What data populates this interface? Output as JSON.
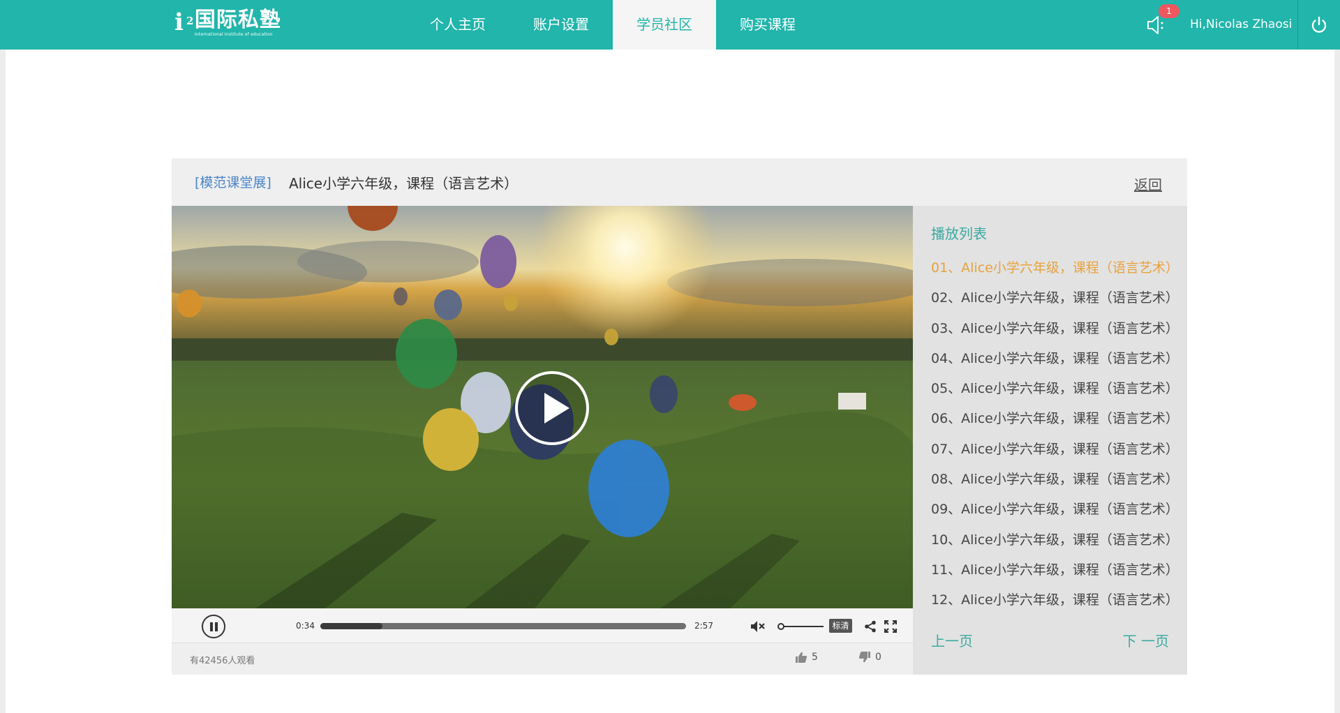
{
  "header": {
    "logo_mark": "i",
    "logo_sup": "2",
    "logo_cn": "国际私塾",
    "logo_en": "International Institute of education",
    "nav": [
      {
        "label": "个人主页",
        "active": false
      },
      {
        "label": "账户设置",
        "active": false
      },
      {
        "label": "学员社区",
        "active": true
      },
      {
        "label": "购买课程",
        "active": false
      }
    ],
    "notification_count": "1",
    "greeting": "Hi,Nicolas Zhaosi"
  },
  "card": {
    "tag": "[模范课堂展]",
    "title": "Alice小学六年级，课程（语言艺术）",
    "back_label": "返回"
  },
  "player": {
    "current_time": "0:34",
    "duration": "2:57",
    "progress": 0.17,
    "volume": 0.0,
    "muted": true,
    "quality_label": "标清",
    "viewers_text": "有42456人观看",
    "likes": "5",
    "dislikes": "0"
  },
  "playlist": {
    "title": "播放列表",
    "items": [
      "01、Alice小学六年级，课程（语言艺术）",
      "02、Alice小学六年级，课程（语言艺术）",
      "03、Alice小学六年级，课程（语言艺术）",
      "04、Alice小学六年级，课程（语言艺术）",
      "05、Alice小学六年级，课程（语言艺术）",
      "06、Alice小学六年级，课程（语言艺术）",
      "07、Alice小学六年级，课程（语言艺术）",
      "08、Alice小学六年级，课程（语言艺术）",
      "09、Alice小学六年级，课程（语言艺术）",
      "10、Alice小学六年级，课程（语言艺术）",
      "11、Alice小学六年级，课程（语言艺术）",
      "12、Alice小学六年级，课程（语言艺术）"
    ],
    "current_index": 0,
    "prev_label": "上一页",
    "next_label": "下 一页"
  },
  "colors": {
    "brand": "#21b5ab",
    "accent_current": "#e8a23c",
    "badge": "#f0575e",
    "tag_blue": "#4a86c9"
  },
  "icons": {
    "speaker": "speaker-icon",
    "power": "power-icon",
    "play": "play-icon",
    "pause": "pause-icon",
    "mute": "mute-icon",
    "share": "share-icon",
    "fullscreen": "fullscreen-icon",
    "thumbs_up": "thumbs-up-icon",
    "thumbs_down": "thumbs-down-icon"
  }
}
